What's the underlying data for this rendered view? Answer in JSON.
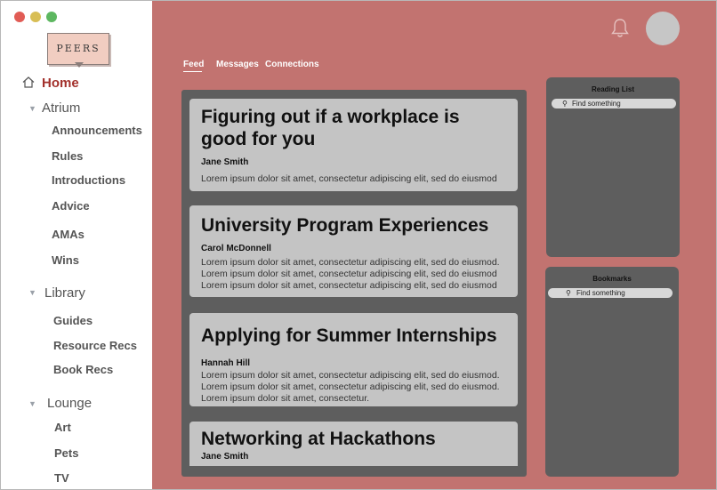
{
  "window": {
    "controls": [
      "close",
      "minimize",
      "maximize"
    ],
    "colors": {
      "close": "#e15c55",
      "minimize": "#d8be55",
      "maximize": "#5db760"
    }
  },
  "logo": {
    "text": "PEERS"
  },
  "sidebar": {
    "home": {
      "label": "Home",
      "icon": "home-icon"
    },
    "sections": [
      {
        "label": "Atrium",
        "items": [
          "Announcements",
          "Rules",
          "Introductions",
          "Advice",
          "AMAs",
          "Wins"
        ]
      },
      {
        "label": "Library",
        "items": [
          "Guides",
          "Resource Recs",
          "Book Recs"
        ]
      },
      {
        "label": "Lounge",
        "items": [
          "Art",
          "Pets",
          "TV"
        ]
      }
    ]
  },
  "header": {
    "tabs": [
      {
        "label": "Feed",
        "active": true
      },
      {
        "label": "Messages",
        "active": false
      },
      {
        "label": "Connections",
        "active": false
      }
    ],
    "notification_icon": "bell-icon"
  },
  "feed": {
    "posts": [
      {
        "title": "Figuring out if a workplace is good for you",
        "author": "Jane Smith",
        "body": [
          "Lorem ipsum dolor sit amet, consectetur adipiscing elit, sed do eiusmod"
        ]
      },
      {
        "title": "University Program Experiences",
        "author": "Carol McDonnell",
        "body": [
          "Lorem ipsum dolor sit amet, consectetur adipiscing elit, sed do eiusmod.",
          "Lorem ipsum dolor sit amet, consectetur adipiscing elit, sed do eiusmod",
          "Lorem ipsum dolor sit amet, consectetur adipiscing elit, sed do eiusmod"
        ]
      },
      {
        "title": "Applying for Summer Internships",
        "author": "Hannah Hill",
        "body": [
          "Lorem ipsum dolor sit amet, consectetur adipiscing elit, sed do eiusmod.",
          "Lorem ipsum dolor sit amet, consectetur adipiscing elit, sed do eiusmod.",
          "Lorem ipsum dolor sit amet, consectetur."
        ]
      },
      {
        "title": "Networking at Hackathons",
        "author": "Jane Smith",
        "body": []
      }
    ]
  },
  "reading_list": {
    "title": "Reading List",
    "search_placeholder": "Find something"
  },
  "bookmarks": {
    "title": "Bookmarks",
    "search_placeholder": "Find something"
  },
  "colors": {
    "background": "#c27370",
    "home_active": "#a3312c",
    "panel": "#5e5e5e",
    "card": "#c4c4c4"
  }
}
